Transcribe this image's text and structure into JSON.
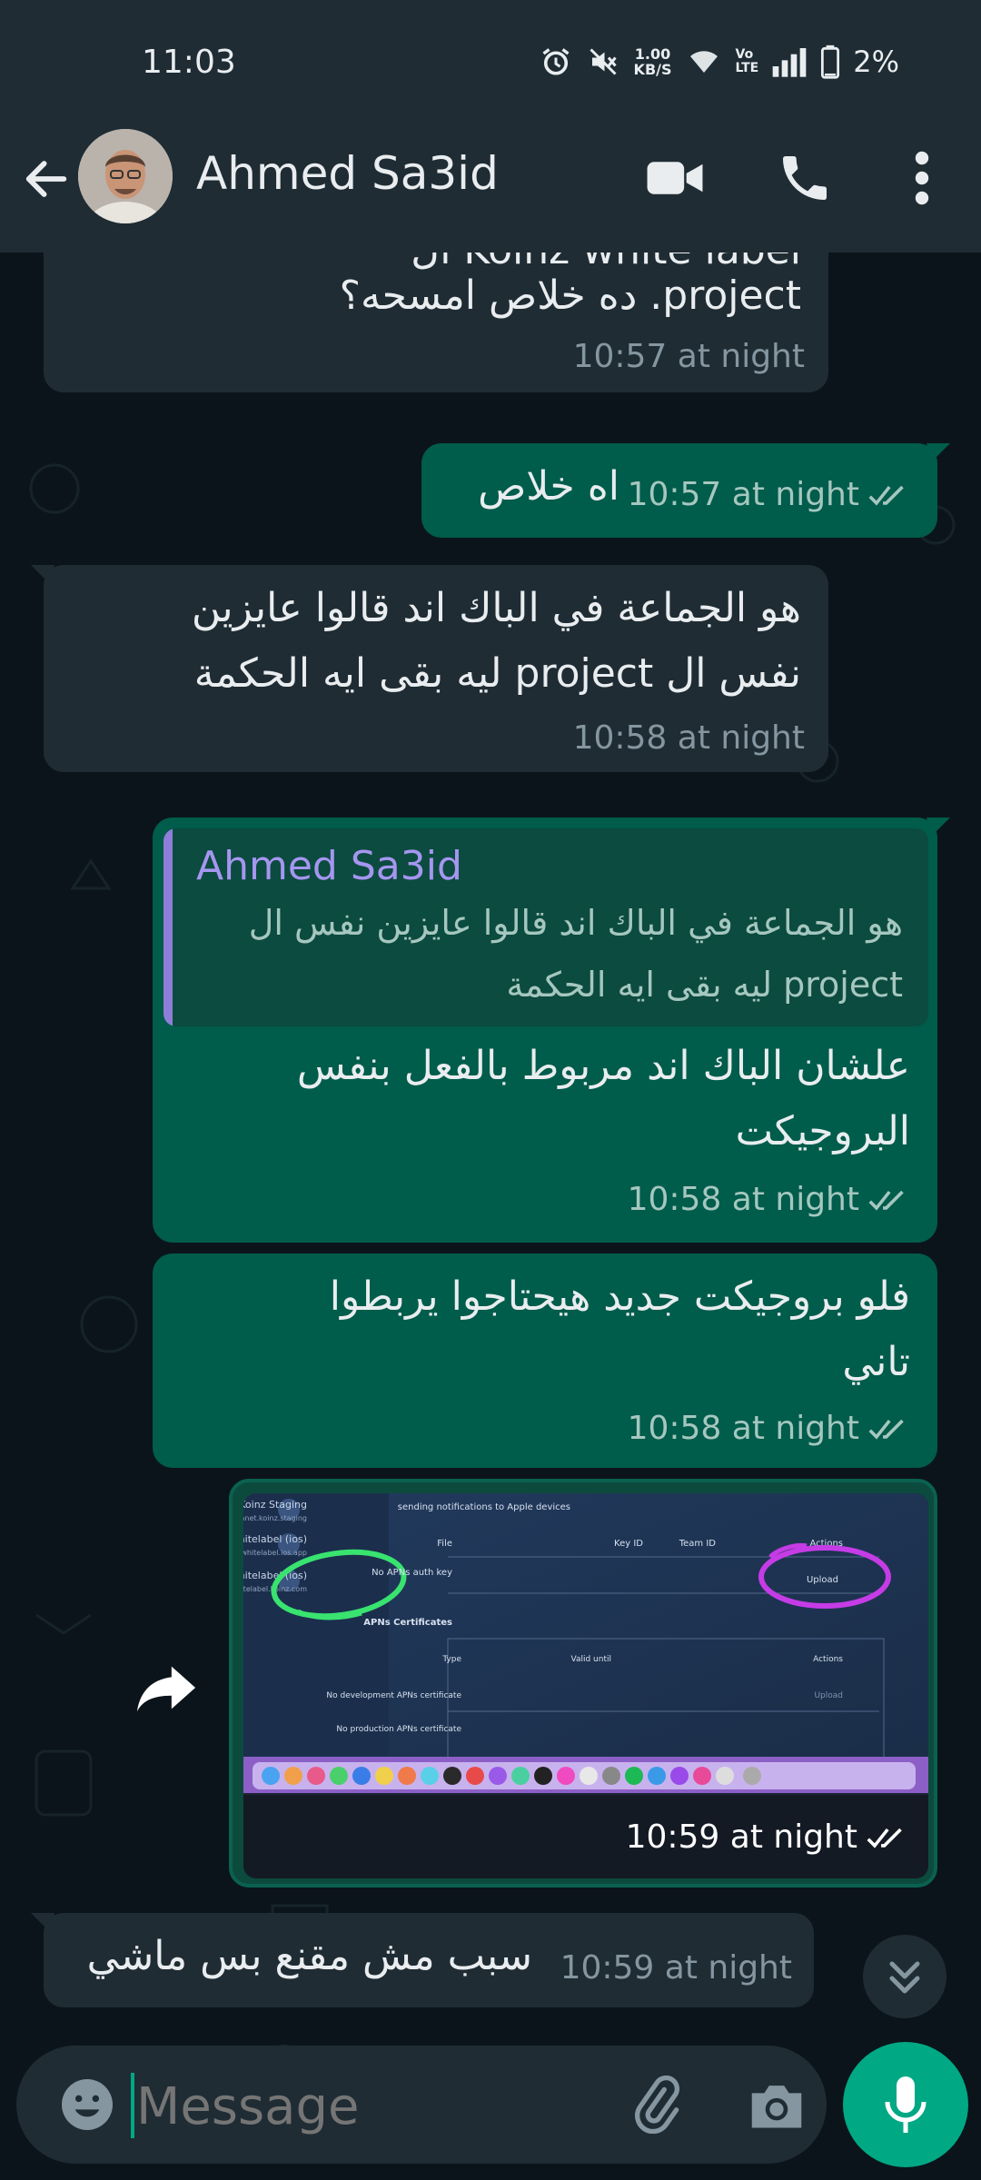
{
  "status_bar": {
    "time": "11:03",
    "net_speed_value": "1.00",
    "net_speed_unit": "KB/S",
    "volte_top": "Vo",
    "volte_bottom": "LTE",
    "battery": "2%"
  },
  "header": {
    "contact_name": "Ahmed Sa3id"
  },
  "messages": [
    {
      "direction": "incoming",
      "text_partial_top": "Koinz white label ال",
      "text": "project. ده خلاص امسحه؟",
      "time": "10:57 at night"
    },
    {
      "direction": "outgoing",
      "text": "اه خلاص",
      "time": "10:57 at night",
      "status": "read"
    },
    {
      "direction": "incoming",
      "text_line1": "هو الجماعة في الباك اند قالوا عايزين",
      "text_line2": "نفس ال project ليه بقى ايه الحكمة",
      "time": "10:58 at night"
    },
    {
      "direction": "outgoing",
      "reply_to": {
        "author": "Ahmed Sa3id",
        "line1": "هو الجماعة في الباك اند قالوا عايزين نفس ال",
        "line2": "project ليه بقى ايه الحكمة"
      },
      "text_line1": "علشان الباك اند مربوط بالفعل بنفس",
      "text_line2": "البروجيكت",
      "time": "10:58 at night",
      "status": "read"
    },
    {
      "direction": "outgoing",
      "text_line1": "فلو بروجيكت جديد هيحتاجوا يربطوا",
      "text_line2": "تاني",
      "time": "10:58 at night",
      "status": "read"
    },
    {
      "direction": "outgoing",
      "type": "image",
      "time": "10:59 at night",
      "status": "read"
    },
    {
      "direction": "incoming",
      "text": "سبب مش مقنع بس ماشي",
      "time": "10:59 at night"
    }
  ],
  "image_content": {
    "items": [
      {
        "title": "Koinz Staging",
        "subtitle": "tech.gplanet.koinz.staging"
      },
      {
        "title": "whitelabel (ios)",
        "subtitle": "com.whitelabel.ios.app"
      },
      {
        "title": "whitelabel (ios)",
        "subtitle": "whitelabel.koinz.com"
      }
    ],
    "top_note": "sending notifications to Apple devices",
    "table_headers": [
      "File",
      "Key ID",
      "Team ID",
      "Actions"
    ],
    "auth_row": "No APNs auth key",
    "upload_label": "Upload",
    "section_title": "APNs Certificates",
    "cert_headers": [
      "Type",
      "Valid until",
      "Actions"
    ],
    "cert_rows": [
      "No development APNs certificate",
      "No production APNs certificate"
    ],
    "upload_label_dim": "Upload"
  },
  "input": {
    "placeholder": "Message"
  },
  "colors": {
    "outgoing_bubble": "#005c4b",
    "incoming_bubble": "#1f2c34",
    "background": "#0b141a",
    "accent": "#00a884",
    "read_ticks": "#8696a0"
  },
  "icons": [
    "alarm-icon",
    "mute-icon",
    "wifi-icon",
    "signal-icon",
    "battery-icon",
    "back-arrow-icon",
    "video-call-icon",
    "phone-icon",
    "more-vert-icon",
    "forward-icon",
    "double-check-icon",
    "chevrons-down-icon",
    "emoji-icon",
    "attach-icon",
    "camera-icon",
    "mic-icon"
  ]
}
